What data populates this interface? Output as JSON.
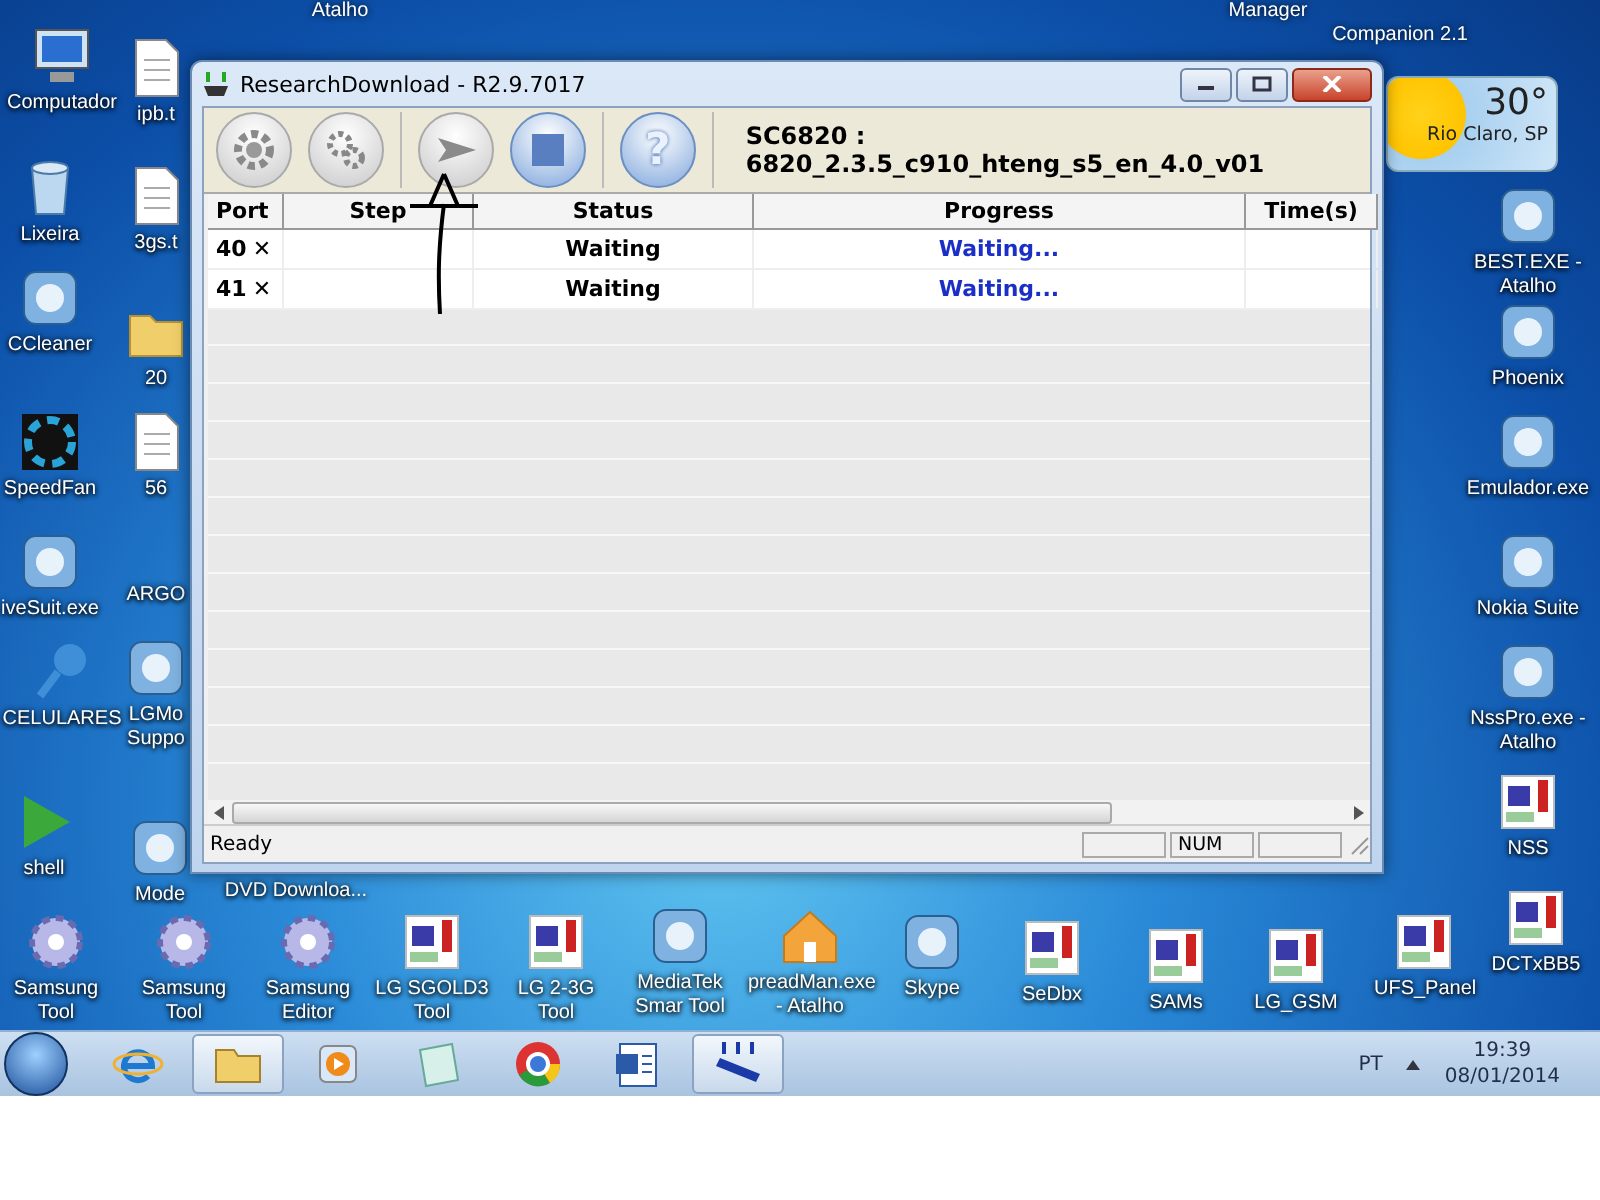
{
  "desktop": {
    "top_labels": [
      "Atalho",
      "Manager",
      "Companion 2.1"
    ],
    "weather": {
      "temperature": "30°",
      "location": "Rio Claro, SP"
    },
    "icons": [
      {
        "label": "Computador",
        "kind": "computer"
      },
      {
        "label": "Lixeira",
        "kind": "bin"
      },
      {
        "label": "CCleaner",
        "kind": "app"
      },
      {
        "label": "SpeedFan",
        "kind": "fan"
      },
      {
        "label": "iveSuit.exe",
        "kind": "app"
      },
      {
        "label": "CELULARES",
        "kind": "pin"
      },
      {
        "label": "shell",
        "kind": "play"
      },
      {
        "label": "ipb.t",
        "kind": "file"
      },
      {
        "label": "3gs.t",
        "kind": "file"
      },
      {
        "label": "20",
        "kind": "folder"
      },
      {
        "label": "56",
        "kind": "file"
      },
      {
        "label": "ARGO",
        "kind": "none"
      },
      {
        "label": "LGMo Suppo",
        "kind": "app"
      },
      {
        "label": "Mode",
        "kind": "app"
      },
      {
        "label": "DVD Downloa...",
        "kind": "none"
      },
      {
        "label": "Samsung Tool",
        "kind": "gear"
      },
      {
        "label": "Samsung Tool",
        "kind": "gear"
      },
      {
        "label": "Samsung Editor",
        "kind": "gear"
      },
      {
        "label": "LG SGOLD3 Tool",
        "kind": "device"
      },
      {
        "label": "LG 2-3G Tool",
        "kind": "device"
      },
      {
        "label": "MediaTek Smar Tool",
        "kind": "app"
      },
      {
        "label": "preadMan.exe - Atalho",
        "kind": "house"
      },
      {
        "label": "Skype",
        "kind": "app"
      },
      {
        "label": "SeDbx",
        "kind": "device"
      },
      {
        "label": "SAMs",
        "kind": "device"
      },
      {
        "label": "LG_GSM",
        "kind": "device"
      },
      {
        "label": "UFS_Panel",
        "kind": "device"
      },
      {
        "label": "BEST.EXE - Atalho",
        "kind": "app"
      },
      {
        "label": "Phoenix",
        "kind": "app"
      },
      {
        "label": "Emulador.exe",
        "kind": "app"
      },
      {
        "label": "Nokia Suite",
        "kind": "app"
      },
      {
        "label": "NssPro.exe - Atalho",
        "kind": "app"
      },
      {
        "label": "NSS",
        "kind": "device"
      },
      {
        "label": "DCTxBB5",
        "kind": "device"
      }
    ]
  },
  "window": {
    "title": "ResearchDownload - R2.9.7017",
    "toolbar_buttons": [
      {
        "kind": "gear"
      },
      {
        "kind": "gears"
      },
      {
        "kind": "play"
      },
      {
        "kind": "stop"
      },
      {
        "kind": "help",
        "label": "?"
      }
    ],
    "firmware": "SC6820 : 6820_2.3.5_c910_hteng_s5_en_4.0_v01",
    "table": {
      "columns": [
        "Port",
        "Step",
        "Status",
        "Progress",
        "Time(s)"
      ],
      "rows": [
        {
          "port": "40",
          "port_mark": "✕",
          "status": "Waiting",
          "progress": "Waiting..."
        },
        {
          "port": "41",
          "port_mark": "✕",
          "status": "Waiting",
          "progress": "Waiting..."
        }
      ]
    },
    "status_bar": {
      "text": "Ready",
      "indicator": "NUM"
    }
  },
  "taskbar": {
    "apps": [
      {
        "kind": "browser-e",
        "running": false
      },
      {
        "kind": "folder",
        "running": true
      },
      {
        "kind": "media",
        "running": false
      },
      {
        "kind": "notepad",
        "running": false
      },
      {
        "kind": "chrome",
        "running": false
      },
      {
        "kind": "word",
        "running": false
      },
      {
        "kind": "download",
        "running": true
      }
    ],
    "language": "PT",
    "time": "19:39",
    "date": "08/01/2014"
  }
}
